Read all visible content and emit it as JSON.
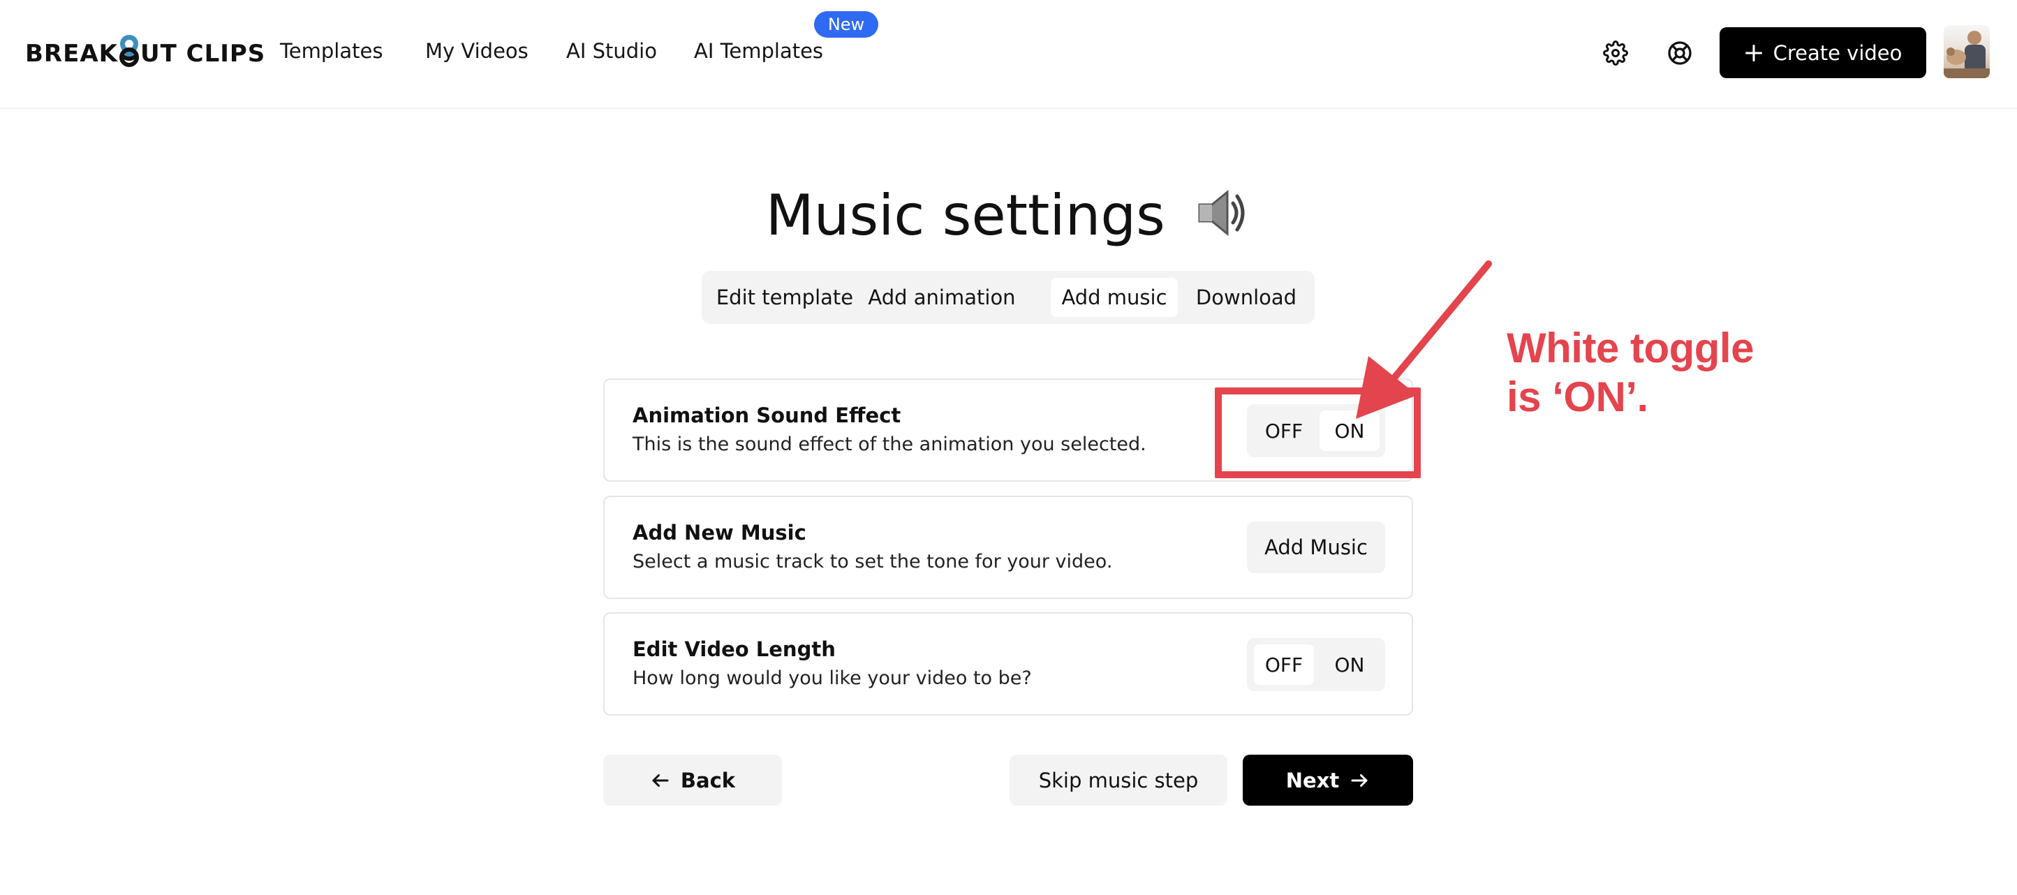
{
  "header": {
    "logo_text_left": "BREAK",
    "logo_text_right": "UT CLIPS",
    "nav": [
      {
        "label": "Templates"
      },
      {
        "label": "My Videos"
      },
      {
        "label": "AI Studio"
      },
      {
        "label": "AI Templates"
      }
    ],
    "new_badge": "New",
    "settings_icon": "gear-icon",
    "help_icon": "lifebuoy-icon",
    "create_button": {
      "icon": "plus-icon",
      "label": "Create video"
    }
  },
  "page": {
    "title": "Music settings",
    "title_icon": "speaker-emoji"
  },
  "steps": [
    {
      "label": "Edit template",
      "active": false
    },
    {
      "label": "Add animation",
      "active": false
    },
    {
      "label": "Add music",
      "active": true
    },
    {
      "label": "Download",
      "active": false
    }
  ],
  "settings": [
    {
      "title": "Animation Sound Effect",
      "description": "This is the sound effect of the animation you selected.",
      "control": "toggle",
      "off_label": "OFF",
      "on_label": "ON",
      "selected": "ON"
    },
    {
      "title": "Add New Music",
      "description": "Select a music track to set the tone for your video.",
      "control": "button",
      "button_label": "Add Music"
    },
    {
      "title": "Edit Video Length",
      "description": "How long would you like your video to be?",
      "control": "toggle",
      "off_label": "OFF",
      "on_label": "ON",
      "selected": "OFF"
    }
  ],
  "footer": {
    "back_label": "Back",
    "back_icon": "arrow-left-icon",
    "skip_label": "Skip music step",
    "next_label": "Next",
    "next_icon": "arrow-right-icon"
  },
  "annotation": {
    "line1": "White toggle",
    "line2": "is ‘ON’.",
    "color": "#e4444d"
  },
  "colors": {
    "accent_badge": "#2f6bf2",
    "primary_button": "#000000",
    "secondary_button": "#f3f3f3",
    "annotation_red": "#e4444d"
  }
}
